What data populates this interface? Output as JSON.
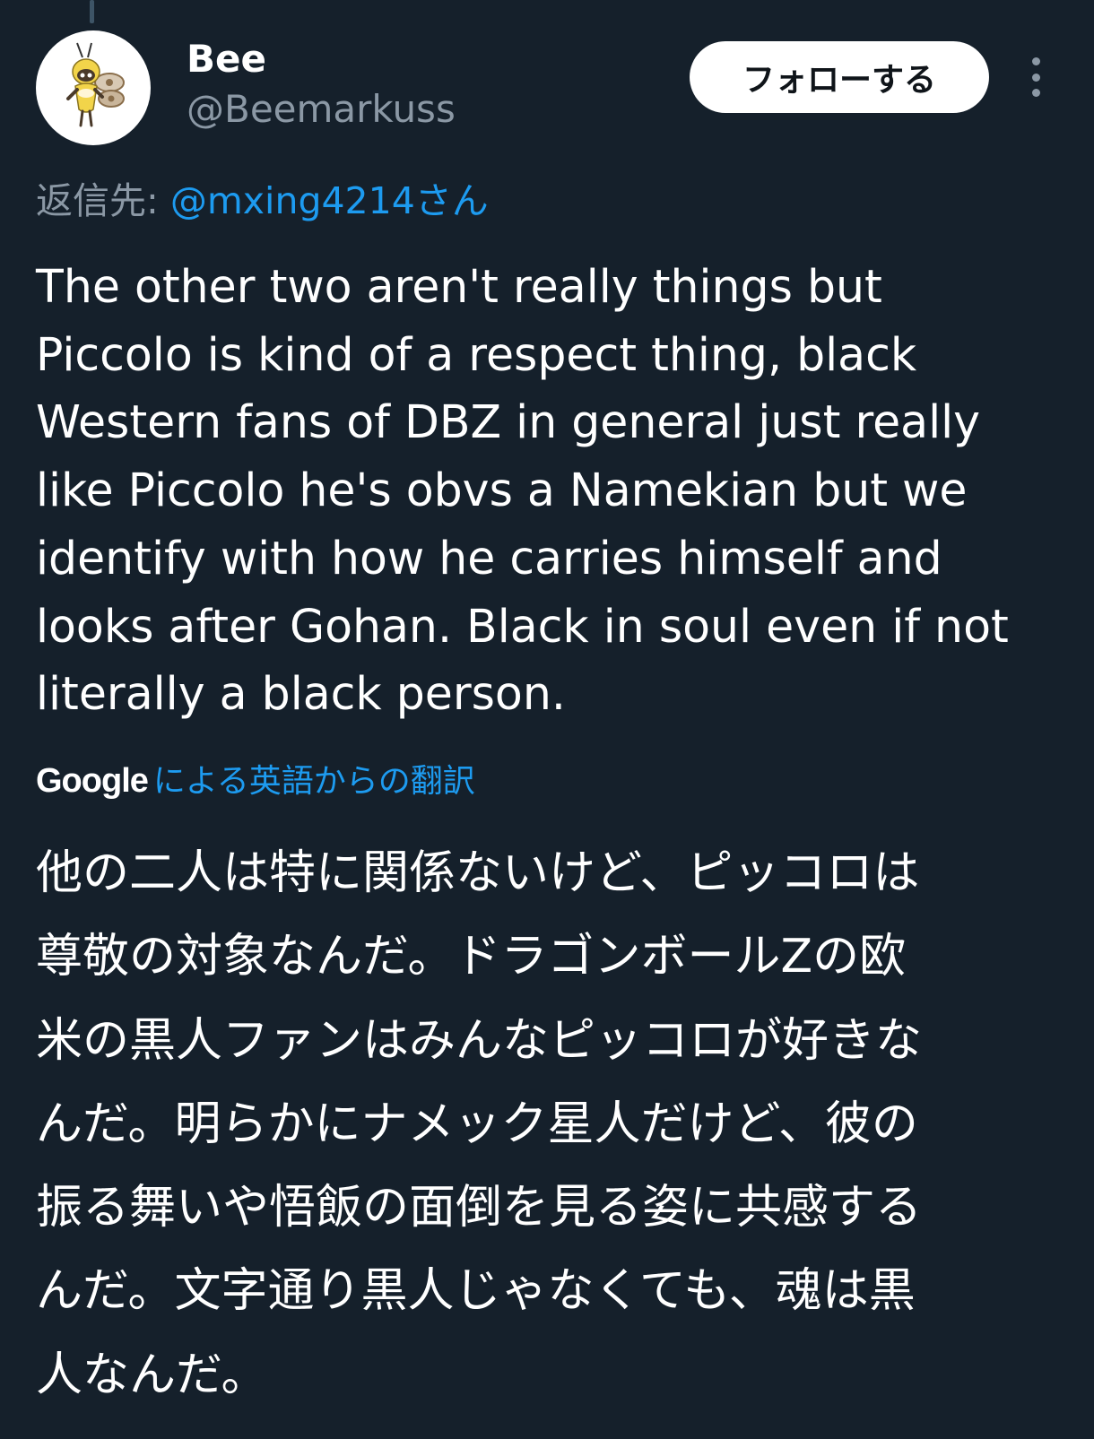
{
  "author": {
    "display_name": "Bee",
    "handle": "@Beemarkuss",
    "avatar_icon": "ribombee-avatar-icon"
  },
  "follow_button": {
    "label": "フォローする"
  },
  "more_menu_icon": "more-vertical-icon",
  "reply": {
    "prefix": "返信先: ",
    "target": "@mxing4214さん"
  },
  "tweet": {
    "lines": [
      "The other two aren't really things but",
      "Piccolo is kind of a respect thing, black",
      "Western fans of DBZ in general just really",
      "like Piccolo he's obvs a Namekian but we",
      "identify with how he carries himself and",
      "looks after Gohan. Black in soul even if not",
      "literally a black person."
    ]
  },
  "translation": {
    "provider": "Google",
    "link_label": "による英語からの翻訳",
    "lines": [
      "他の二人は特に関係ないけど、ピッコロは",
      "尊敬の対象なんだ。ドラゴンボールZの欧",
      "米の黒人ファンはみんなピッコロが好きな",
      "んだ。明らかにナメック星人だけど、彼の",
      "振る舞いや悟飯の面倒を見る姿に共感する",
      "んだ。文字通り黒人じゃなくても、魂は黒",
      "人なんだ。"
    ]
  },
  "colors": {
    "background": "#15202b",
    "primary_text": "#ffffff",
    "secondary_text": "#8b98a5",
    "link": "#1d9bf0",
    "follow_button_bg": "#ffffff",
    "follow_button_text": "#0f1419"
  }
}
